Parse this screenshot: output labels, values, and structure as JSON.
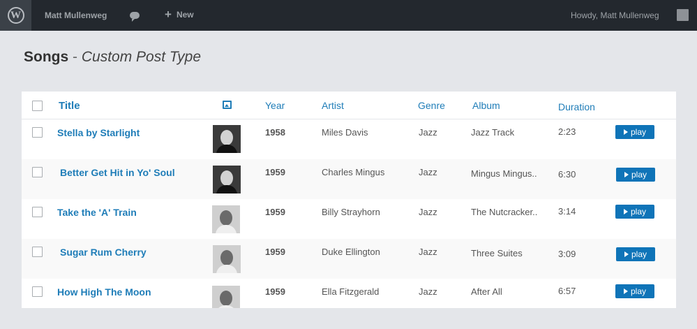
{
  "adminbar": {
    "user": "Matt Mullenweg",
    "new_label": "New",
    "howdy": "Howdy,  Matt Mullenweg"
  },
  "page": {
    "title": "Songs",
    "separator": "-",
    "subtitle": "Custom Post Type"
  },
  "table": {
    "columns": {
      "title": "Title",
      "image": "image-icon",
      "year": "Year",
      "artist": "Artist",
      "genre": "Genre",
      "album": "Album",
      "duration": "Duration"
    },
    "play_label": "play",
    "rows": [
      {
        "title": "Stella by Starlight",
        "year": "1958",
        "artist": "Miles Davis",
        "genre": "Jazz",
        "album": "Jazz Track",
        "duration": "2:23"
      },
      {
        "title": "Better Get Hit in Yo' Soul",
        "year": "1959",
        "artist": "Charles Mingus",
        "genre": "Jazz",
        "album": "Mingus Mingus..",
        "duration": "6:30"
      },
      {
        "title": "Take the 'A' Train",
        "year": "1959",
        "artist": "Billy Strayhorn",
        "genre": "Jazz",
        "album": "The Nutcracker..",
        "duration": "3:14"
      },
      {
        "title": "Sugar Rum Cherry",
        "year": "1959",
        "artist": "Duke Ellington",
        "genre": "Jazz",
        "album": "Three Suites",
        "duration": "3:09"
      },
      {
        "title": "How High The Moon",
        "year": "1959",
        "artist": "Ella Fitzgerald",
        "genre": "Jazz",
        "album": "After All",
        "duration": "6:57"
      }
    ]
  },
  "colors": {
    "adminbar_bg": "#23282e",
    "link_blue": "#1f7db8",
    "button_blue": "#0f74b8",
    "page_bg": "#e4e6ea"
  }
}
